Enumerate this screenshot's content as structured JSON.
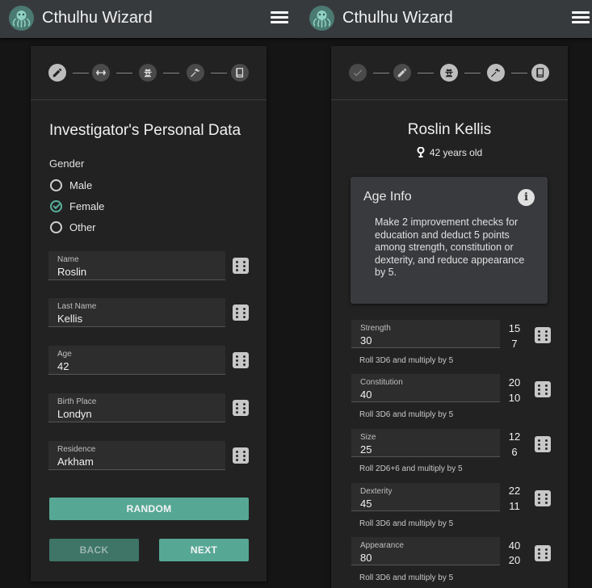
{
  "app": {
    "title": "Cthulhu Wizard"
  },
  "icons": {
    "logo": "cthulhu-logo-icon",
    "menu": "hamburger-menu-icon",
    "dice": "dice-icon",
    "info": "info-icon",
    "age": "person-pin-icon"
  },
  "colors": {
    "accent": "#56a895",
    "appbar": "#373a3d",
    "card": "#222222"
  },
  "left": {
    "steps": [
      "pencil-icon",
      "dumbbell-icon",
      "detective-icon",
      "hammer-icon",
      "book-icon"
    ],
    "heading": "Investigator's Personal Data",
    "gender": {
      "label": "Gender",
      "options": [
        {
          "label": "Male",
          "checked": false
        },
        {
          "label": "Female",
          "checked": true
        },
        {
          "label": "Other",
          "checked": false
        }
      ]
    },
    "fields": [
      {
        "label": "Name",
        "value": "Roslin"
      },
      {
        "label": "Last Name",
        "value": "Kellis"
      },
      {
        "label": "Age",
        "value": "42"
      },
      {
        "label": "Birth Place",
        "value": "Londyn"
      },
      {
        "label": "Residence",
        "value": "Arkham"
      }
    ],
    "buttons": {
      "random": "RANDOM",
      "back": "BACK",
      "next": "NEXT"
    }
  },
  "right": {
    "steps": [
      "check-icon",
      "pencil-icon",
      "detective-icon",
      "hammer-icon",
      "book-icon"
    ],
    "name": "Roslin Kellis",
    "age_text": "42 years old",
    "age_info": {
      "title": "Age Info",
      "text": "Make 2 improvement checks for education and deduct 5 points among strength, constitution or dexterity, and reduce appearance by 5."
    },
    "attributes": [
      {
        "label": "Strength",
        "value": "30",
        "full": "15",
        "fifth": "7",
        "hint": "Roll 3D6 and multiply by 5"
      },
      {
        "label": "Constitution",
        "value": "40",
        "full": "20",
        "fifth": "10",
        "hint": "Roll 3D6 and multiply by 5"
      },
      {
        "label": "Size",
        "value": "25",
        "full": "12",
        "fifth": "6",
        "hint": "Roll 2D6+6 and multiply by 5"
      },
      {
        "label": "Dexterity",
        "value": "45",
        "full": "22",
        "fifth": "11",
        "hint": "Roll 3D6 and multiply by 5"
      },
      {
        "label": "Appearance",
        "value": "80",
        "full": "40",
        "fifth": "20",
        "hint": "Roll 3D6 and multiply by 5"
      }
    ]
  }
}
